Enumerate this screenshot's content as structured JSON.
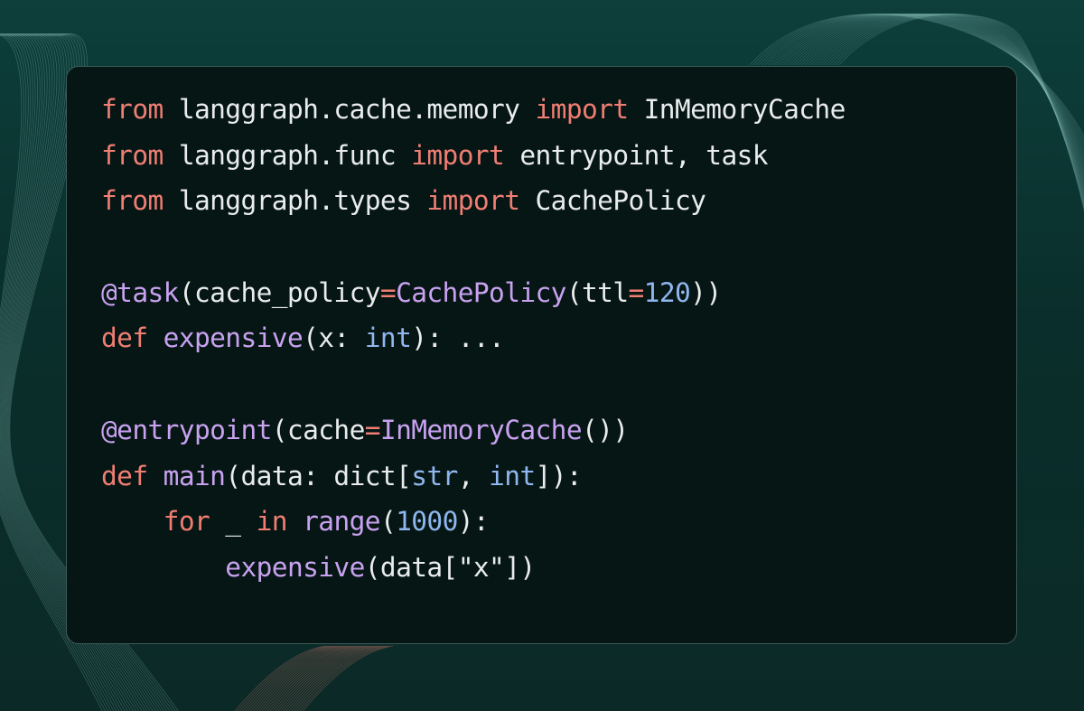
{
  "code": {
    "lines": [
      [
        {
          "t": "from",
          "c": "kw"
        },
        {
          "t": " langgraph.cache.memory ",
          "c": "pl"
        },
        {
          "t": "import",
          "c": "kw"
        },
        {
          "t": " InMemoryCache",
          "c": "pl"
        }
      ],
      [
        {
          "t": "from",
          "c": "kw"
        },
        {
          "t": " langgraph.func ",
          "c": "pl"
        },
        {
          "t": "import",
          "c": "kw"
        },
        {
          "t": " entrypoint, task",
          "c": "pl"
        }
      ],
      [
        {
          "t": "from",
          "c": "kw"
        },
        {
          "t": " langgraph.types ",
          "c": "pl"
        },
        {
          "t": "import",
          "c": "kw"
        },
        {
          "t": " CachePolicy",
          "c": "pl"
        }
      ],
      [],
      [
        {
          "t": "@task",
          "c": "fn"
        },
        {
          "t": "(cache_policy",
          "c": "pl"
        },
        {
          "t": "=",
          "c": "kw"
        },
        {
          "t": "CachePolicy",
          "c": "fn"
        },
        {
          "t": "(ttl",
          "c": "pl"
        },
        {
          "t": "=",
          "c": "kw"
        },
        {
          "t": "120",
          "c": "num"
        },
        {
          "t": "))",
          "c": "pl"
        }
      ],
      [
        {
          "t": "def",
          "c": "kw"
        },
        {
          "t": " ",
          "c": "pl"
        },
        {
          "t": "expensive",
          "c": "fn"
        },
        {
          "t": "(x: ",
          "c": "pl"
        },
        {
          "t": "int",
          "c": "ty"
        },
        {
          "t": "): ...",
          "c": "pl"
        }
      ],
      [],
      [
        {
          "t": "@entrypoint",
          "c": "fn"
        },
        {
          "t": "(cache",
          "c": "pl"
        },
        {
          "t": "=",
          "c": "kw"
        },
        {
          "t": "InMemoryCache",
          "c": "fn"
        },
        {
          "t": "())",
          "c": "pl"
        }
      ],
      [
        {
          "t": "def",
          "c": "kw"
        },
        {
          "t": " ",
          "c": "pl"
        },
        {
          "t": "main",
          "c": "fn"
        },
        {
          "t": "(data: dict[",
          "c": "pl"
        },
        {
          "t": "str",
          "c": "ty"
        },
        {
          "t": ", ",
          "c": "pl"
        },
        {
          "t": "int",
          "c": "ty"
        },
        {
          "t": "]):",
          "c": "pl"
        }
      ],
      [
        {
          "t": "    ",
          "c": "pl"
        },
        {
          "t": "for",
          "c": "kw"
        },
        {
          "t": " _ ",
          "c": "pl"
        },
        {
          "t": "in",
          "c": "kw"
        },
        {
          "t": " ",
          "c": "pl"
        },
        {
          "t": "range",
          "c": "fn"
        },
        {
          "t": "(",
          "c": "pl"
        },
        {
          "t": "1000",
          "c": "num"
        },
        {
          "t": "):",
          "c": "pl"
        }
      ],
      [
        {
          "t": "        ",
          "c": "pl"
        },
        {
          "t": "expensive",
          "c": "fn"
        },
        {
          "t": "(data[\"x\"])",
          "c": "pl"
        }
      ]
    ]
  },
  "colors": {
    "keyword": "#f07e73",
    "function": "#c8a2f0",
    "number": "#8fb6ee",
    "plain": "#e9ecec",
    "card_background": "#061614",
    "page_background": "#0b2e2b"
  }
}
